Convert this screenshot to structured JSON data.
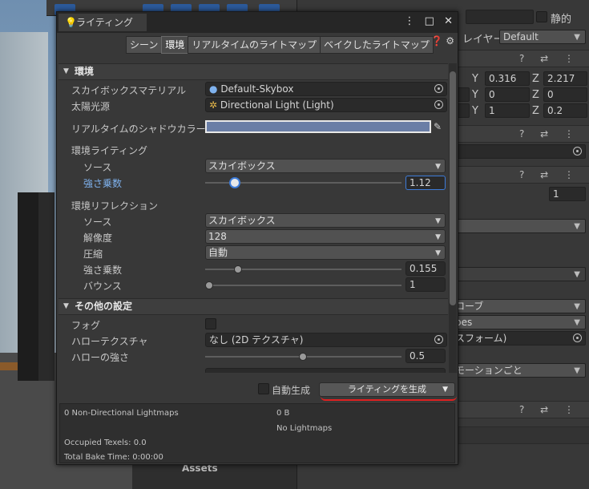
{
  "window": {
    "tab_title": "ライティング",
    "tabs": [
      "シーン",
      "環境",
      "リアルタイムのライトマップ",
      "ベイクしたライトマップ"
    ],
    "active_tab": "環境"
  },
  "environment": {
    "header": "環境",
    "skybox_label": "スカイボックスマテリアル",
    "skybox_value": "Default-Skybox",
    "sun_label": "太陽光源",
    "sun_value": "Directional Light (Light)",
    "shadow_color_label": "リアルタイムのシャドウカラー",
    "shadow_color": "#6a7ea6",
    "env_lighting_label": "環境ライティング",
    "source_label": "ソース",
    "source_value": "スカイボックス",
    "intensity_label": "強さ乗数",
    "intensity_value": "1.12",
    "env_reflection_label": "環境リフレクション",
    "refl_source_label": "ソース",
    "refl_source_value": "スカイボックス",
    "resolution_label": "解像度",
    "resolution_value": "128",
    "compression_label": "圧縮",
    "compression_value": "自動",
    "refl_intensity_label": "強さ乗数",
    "refl_intensity_value": "0.155",
    "bounce_label": "バウンス",
    "bounce_value": "1"
  },
  "other": {
    "header": "その他の設定",
    "fog_label": "フォグ",
    "halo_texture_label": "ハローテクスチャ",
    "halo_texture_value": "なし (2D テクスチャ)",
    "halo_strength_label": "ハローの強さ",
    "halo_strength_value": "0.5"
  },
  "bottom": {
    "auto_generate_label": "自動生成",
    "generate_button": "ライティングを生成"
  },
  "stats": {
    "lightmaps": "0 Non-Directional Lightmaps",
    "size": "0 B",
    "no_lightmaps": "No Lightmaps",
    "texels": "Occupied Texels: 0.0",
    "bake_time": "Total Bake Time: 0:00:00"
  },
  "inspector": {
    "static_label": "静的",
    "layer_label": "レイヤー",
    "layer_value": "Default",
    "pos_y": "0.316",
    "pos_z": "2.217",
    "rot_y": "0",
    "rot_z": "0",
    "scale_y": "1",
    "scale_z": "0.2",
    "int_field": "1",
    "dd_probes": "ローブ",
    "dd_bes": "bes",
    "dd_transform": "スフォーム)",
    "dd_motion": "モーションごと",
    "axis_y": "Y",
    "axis_z": "Z"
  },
  "project": {
    "assets_label": "Assets"
  }
}
